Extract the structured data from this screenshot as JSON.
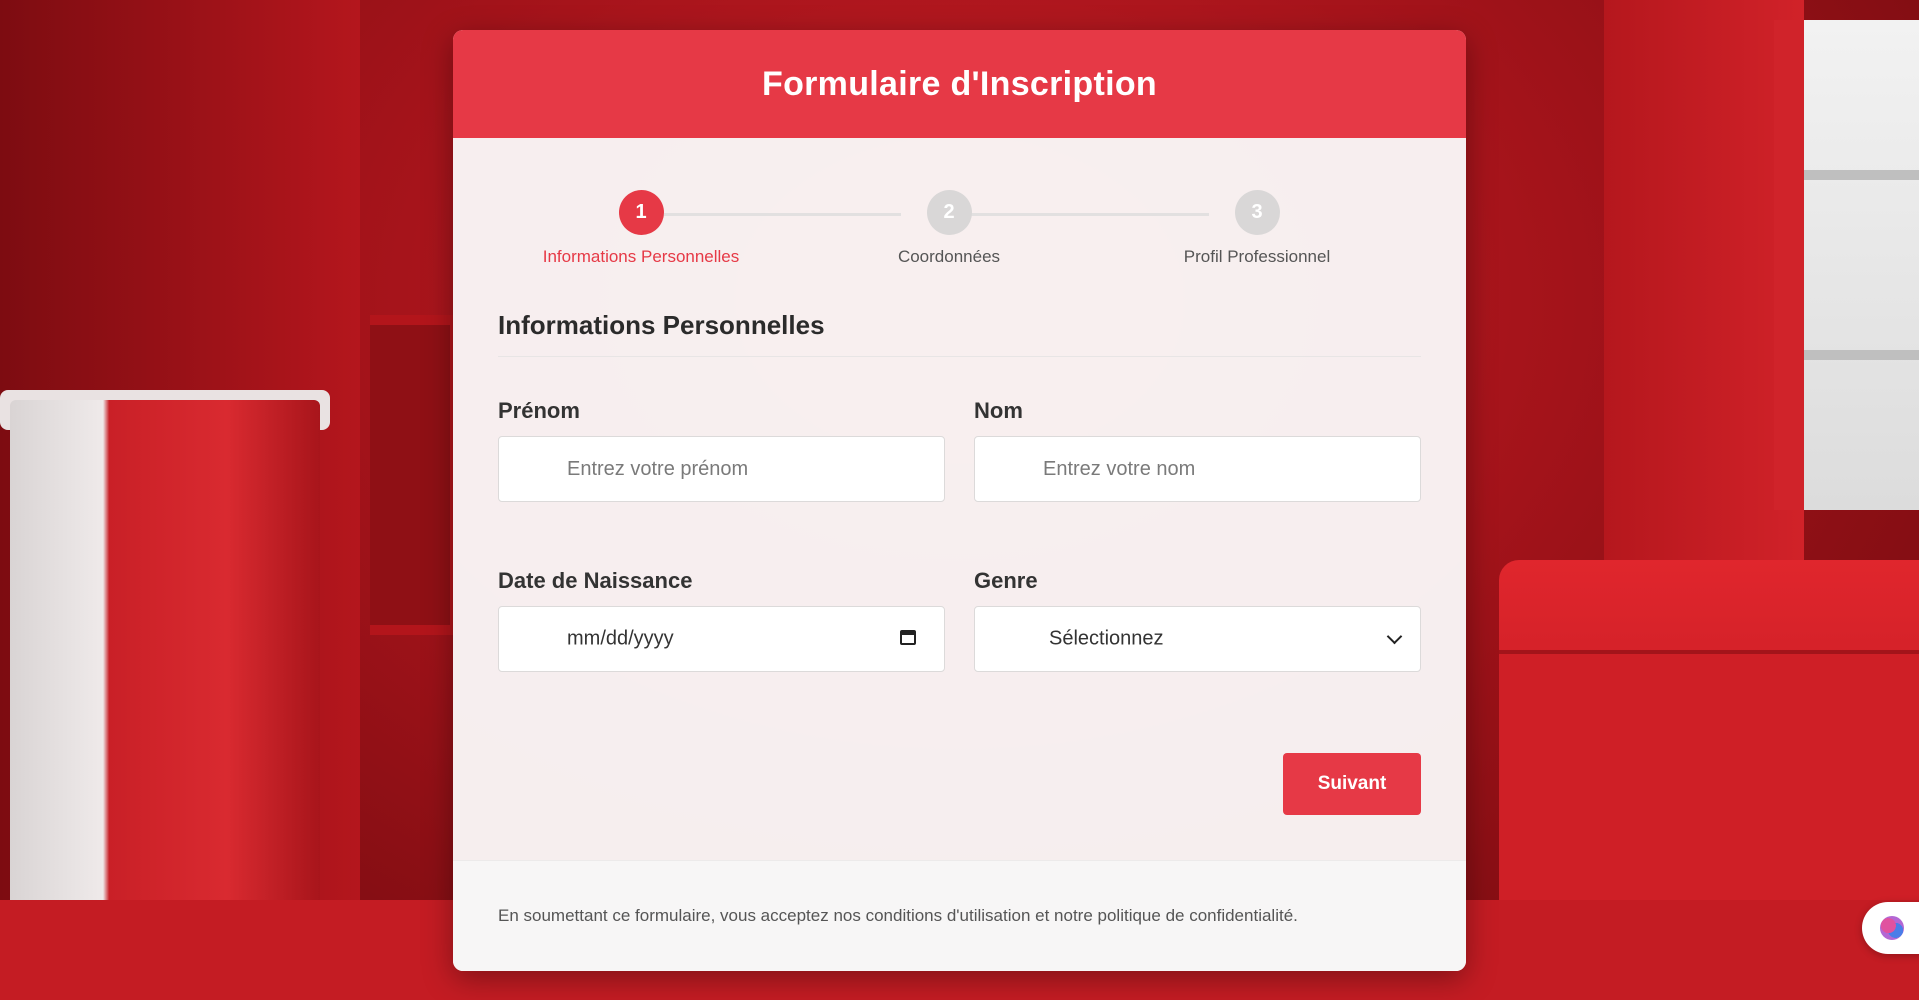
{
  "header": {
    "title": "Formulaire d'Inscription"
  },
  "stepper": {
    "steps": [
      {
        "number": "1",
        "label": "Informations Personnelles",
        "active": true
      },
      {
        "number": "2",
        "label": "Coordonnées",
        "active": false
      },
      {
        "number": "3",
        "label": "Profil Professionnel",
        "active": false
      }
    ]
  },
  "section": {
    "title": "Informations Personnelles"
  },
  "fields": {
    "prenom": {
      "label": "Prénom",
      "placeholder": "Entrez votre prénom"
    },
    "nom": {
      "label": "Nom",
      "placeholder": "Entrez votre nom"
    },
    "birthdate": {
      "label": "Date de Naissance",
      "value": "mm/dd/yyyy",
      "icon": "calendar-icon"
    },
    "genre": {
      "label": "Genre",
      "value": "Sélectionnez",
      "icon": "chevron-down-icon"
    }
  },
  "actions": {
    "next_label": "Suivant"
  },
  "footer": {
    "text": "En soumettant ce formulaire, vous acceptez nos conditions d'utilisation et notre politique de confidentialité."
  },
  "colors": {
    "accent": "#e63946",
    "inactive_step": "#d9d7d7",
    "text_dark": "#2b2b2b",
    "text_muted": "#555555"
  },
  "extension": {
    "icon": "brain-icon"
  }
}
